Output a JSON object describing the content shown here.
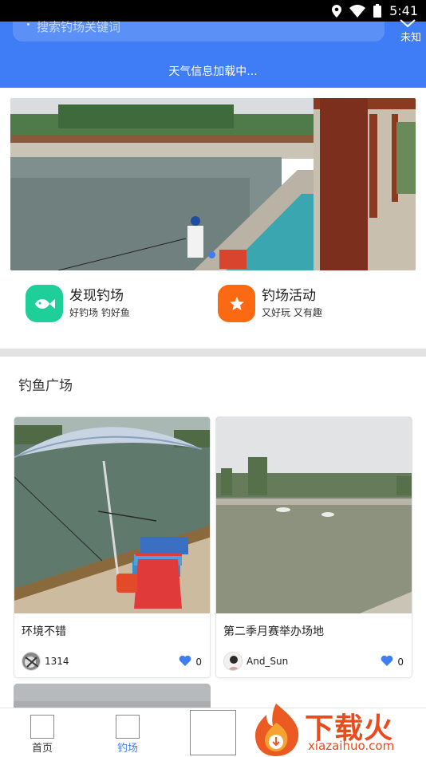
{
  "status_bar": {
    "time": "5:41"
  },
  "header": {
    "search_placeholder": "搜索钓场关键词",
    "weather_label": "未知",
    "weather_loading": "天气信息加载中...",
    "accent_color": "#3f7df6"
  },
  "shortcuts": [
    {
      "title": "发现钓场",
      "subtitle": "好钓场 钓好鱼",
      "icon": "fish-icon",
      "color": "#1fcf9a"
    },
    {
      "title": "钓场活动",
      "subtitle": "又好玩 又有趣",
      "icon": "star-icon",
      "color": "#fb6a13"
    }
  ],
  "plaza": {
    "title": "钓鱼广场",
    "posts": [
      {
        "title": "环境不错",
        "user": "1314",
        "likes": "0"
      },
      {
        "title": "第二季月赛举办场地",
        "user": "And_Sun",
        "likes": "0"
      }
    ]
  },
  "bottom_nav": {
    "items": [
      {
        "label": "首页",
        "active": false
      },
      {
        "label": "钓场",
        "active": true
      }
    ],
    "active_color": "#3f7df6"
  },
  "watermark": {
    "text": "下载火",
    "url": "xiazaihuo.com"
  }
}
